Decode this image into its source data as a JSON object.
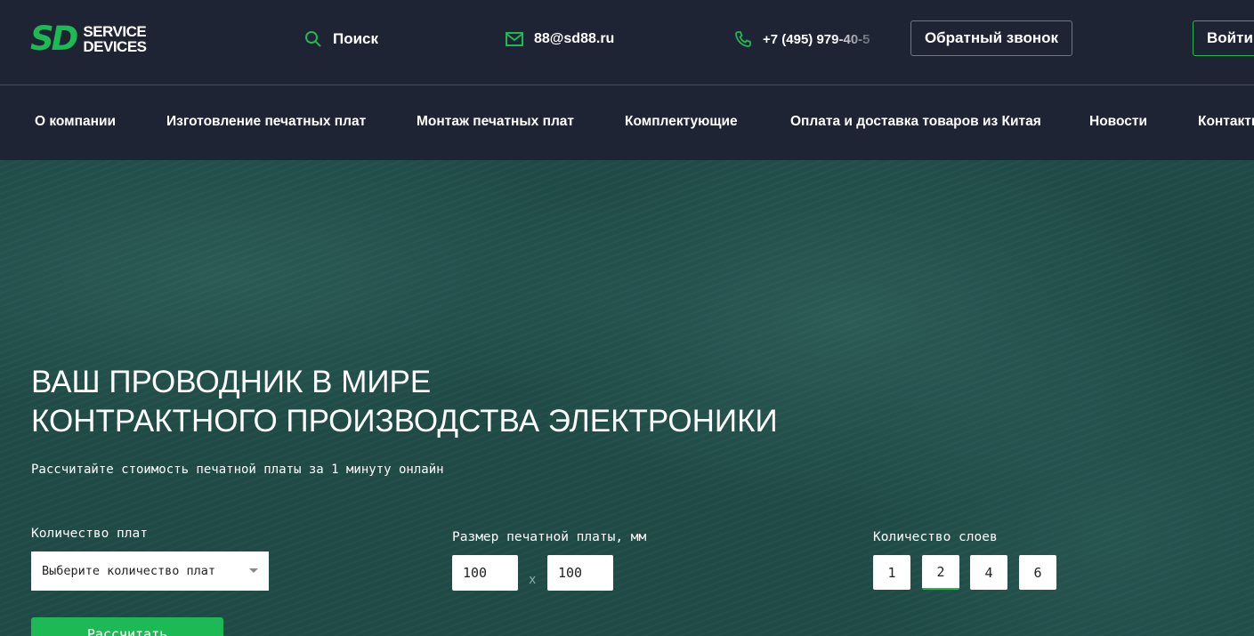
{
  "header": {
    "logo_mark": "SD",
    "logo_line1": "SERVICE",
    "logo_line2": "DEVICES",
    "search_label": "Поиск",
    "email": "88@sd88.ru",
    "phone": "+7 (495) 979-40-5",
    "callback_label": "Обратный звонок",
    "login_label": "Войти",
    "accent_color": "#1db954",
    "icons": [
      "search-icon",
      "mail-icon",
      "phone-icon"
    ]
  },
  "nav": {
    "items": [
      {
        "label": "О компании"
      },
      {
        "label": "Изготовление печатных плат"
      },
      {
        "label": "Монтаж печатных плат"
      },
      {
        "label": "Комплектующие"
      },
      {
        "label": "Оплата и доставка товаров из Китая"
      },
      {
        "label": "Новости"
      },
      {
        "label": "Контакты"
      }
    ]
  },
  "hero": {
    "title_line1": "ВАШ ПРОВОДНИК В МИРЕ",
    "title_line2": "КОНТРАКТНОГО ПРОИЗВОДСТВА ЭЛЕКТРОНИКИ",
    "subtitle": "Рассчитайте стоимость печатной платы за 1 минуту онлайн"
  },
  "calculator": {
    "quantity_label": "Количество плат",
    "quantity_placeholder": "Выберите количество плат",
    "size_label": "Размер печатной платы, мм",
    "size_width": "100",
    "size_separator": "x",
    "size_height": "100",
    "layers_label": "Количество слоев",
    "layers": [
      "1",
      "2",
      "4",
      "6"
    ],
    "layers_selected": "2",
    "submit_label": "Рассчитать"
  }
}
